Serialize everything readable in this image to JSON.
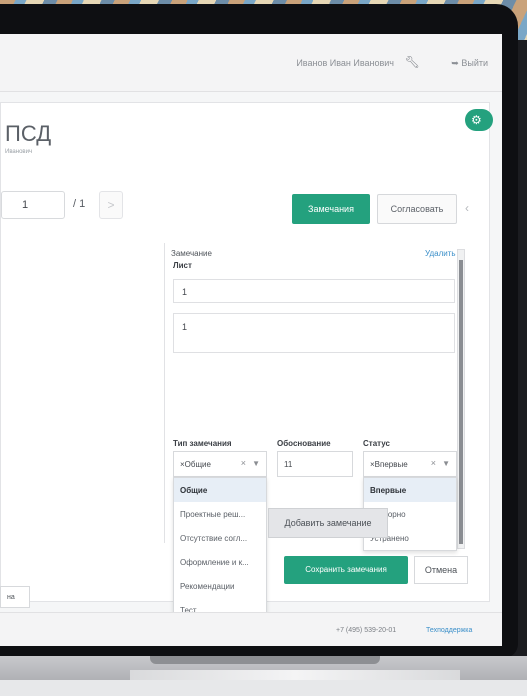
{
  "header": {
    "user_name": "Иванов Иван Иванович",
    "logout_label": "Выйти"
  },
  "document": {
    "title": "ПСД",
    "subtitle": "Иванович"
  },
  "pager": {
    "current_page": "1",
    "total_pages": "/ 1",
    "next_label": ">"
  },
  "toolbar": {
    "remarks_label": "Замечания",
    "approve_label": "Согласовать"
  },
  "remark": {
    "header_label": "Замечание",
    "delete_label": "Удалить",
    "sheet_label": "Лист",
    "sheet_value": "1",
    "text_value": "1",
    "type_label": "Тип замечания",
    "type_value": "×Общие",
    "justification_label": "Обоснование",
    "justification_value": "11",
    "status_label": "Статус",
    "status_value": "×Впервые",
    "type_options": [
      "Общие",
      "Проектные реш...",
      "Отсутствие согл...",
      "Оформление и к...",
      "Рекомендации",
      "Тест"
    ],
    "status_options": [
      "Впервые",
      "Повторно",
      "Устранено"
    ]
  },
  "actions": {
    "add_remark_label": "Добавить замечание",
    "save_remarks_label": "Сохранить замечания",
    "cancel_label": "Отмена",
    "left_button_label": "на"
  },
  "footer": {
    "phone": "+7 (495) 539-20-01",
    "support_label": "Техподдержка"
  },
  "colors": {
    "accent": "#24a17e",
    "link": "#3b8fc9"
  }
}
